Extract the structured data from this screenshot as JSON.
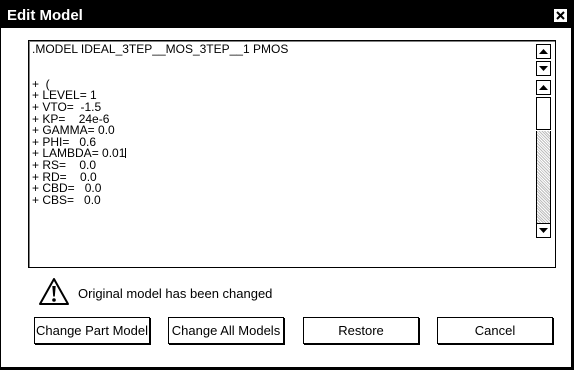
{
  "window": {
    "title": "Edit Model"
  },
  "editor": {
    "lines": [
      ".MODEL IDEAL_3TEP__MOS_3TEP__1 PMOS",
      "",
      "",
      "+  (",
      "+ LEVEL= 1",
      "+ VTO=  -1.5",
      "+ KP=    24e-6",
      "+ GAMMA= 0.0",
      "+ PHI=   0.6",
      "+ LAMBDA= 0.01",
      "+ RS=    0.0",
      "+ RD=    0.0",
      "+ CBD=   0.0",
      "+ CBS=   0.0"
    ],
    "caret_line": 9
  },
  "message": {
    "icon": "warning-icon",
    "text": "Original model has been changed"
  },
  "buttons": {
    "change_part_model": "Change Part Model",
    "change_all_models": "Change All Models",
    "restore": "Restore",
    "cancel": "Cancel"
  }
}
